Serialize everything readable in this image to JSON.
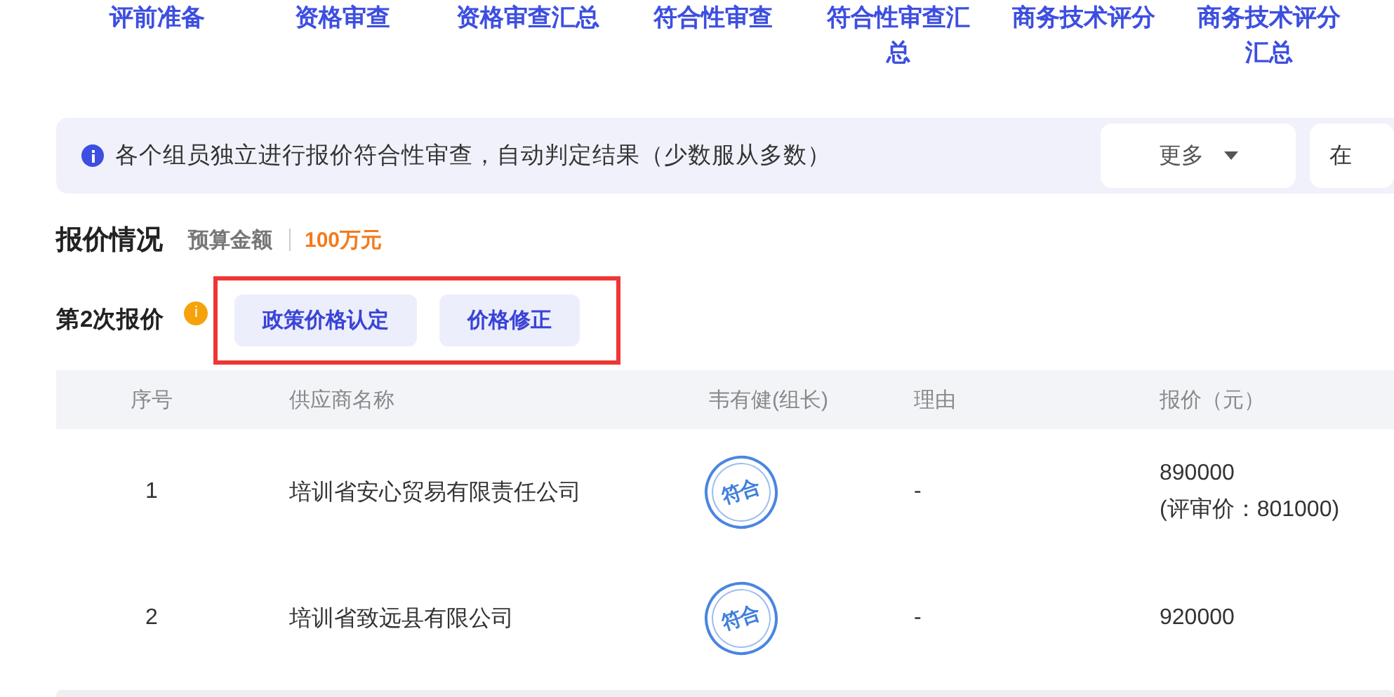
{
  "tabs": [
    "评前准备",
    "资格审查",
    "资格审查汇总",
    "符合性审查",
    "符合性审查汇总",
    "商务技术评分",
    "商务技术评分汇总"
  ],
  "notice": {
    "text": "各个组员独立进行报价符合性审查，自动判定结果（少数服从多数）",
    "buttons": [
      {
        "label": "更多",
        "kind": "dropdown"
      },
      {
        "label": "在",
        "kind": "plain"
      }
    ]
  },
  "quote": {
    "title": "报价情况",
    "budget_label": "预算金额",
    "budget_value": "100万元",
    "round_label": "第2次报价",
    "round_badge": "i",
    "actions": [
      "政策价格认定",
      "价格修正"
    ]
  },
  "table": {
    "columns": [
      "序号",
      "供应商名称",
      "韦有健(组长)",
      "理由",
      "报价（元）"
    ],
    "rows": [
      {
        "index": "1",
        "supplier": "培训省安心贸易有限责任公司",
        "verdict": "符合",
        "reason": "-",
        "price": "890000",
        "review_price": "(评审价：801000)"
      },
      {
        "index": "2",
        "supplier": "培训省致远县有限公司",
        "verdict": "符合",
        "reason": "-",
        "price": "920000"
      }
    ]
  }
}
